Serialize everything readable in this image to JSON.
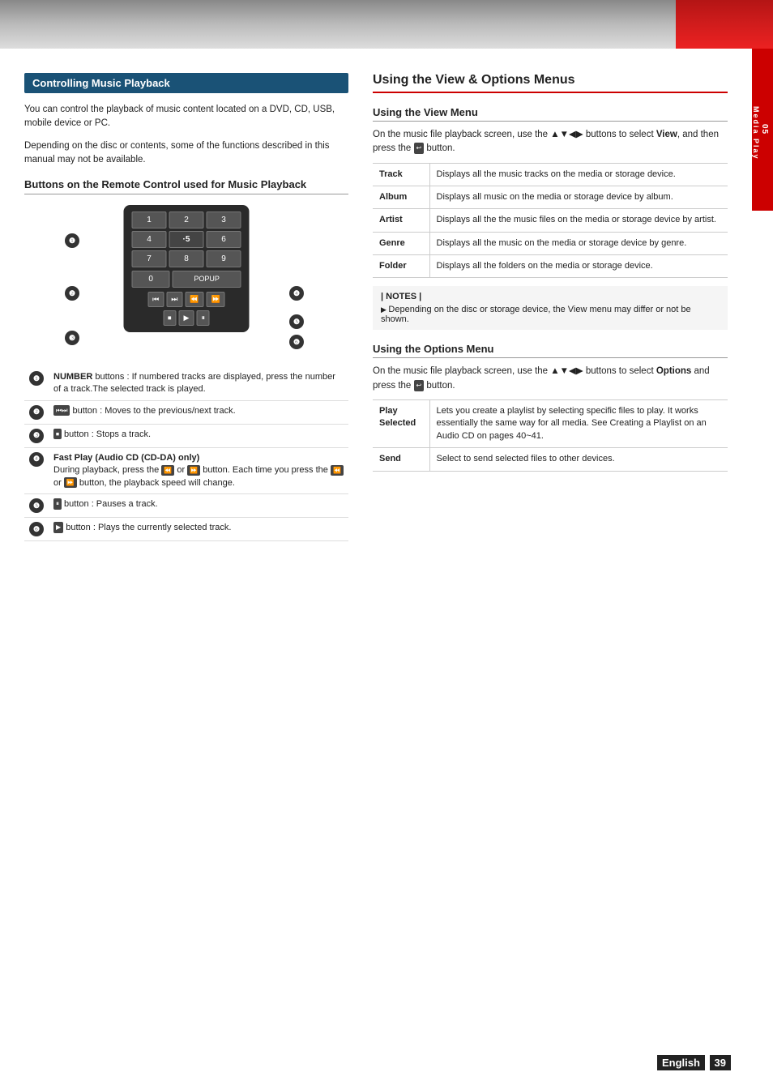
{
  "topBar": {
    "accentColor": "#cc0000"
  },
  "sideTab": {
    "line1": "05",
    "line2": "Media Play"
  },
  "leftSection": {
    "header": "Controlling Music Playback",
    "intro1": "You can control the playback of music content located on a DVD, CD, USB, mobile device or PC.",
    "intro2": "Depending on the disc or contents, some of the functions described in this manual may not be available.",
    "subsectionHeading": "Buttons on the Remote Control used for Music Playback",
    "descItems": [
      {
        "num": "❶",
        "text": "NUMBER buttons : If numbered tracks are displayed, press the number of a track.The selected track is played."
      },
      {
        "num": "❷",
        "text": "⏮ ⏭ button : Moves to the previous/next track."
      },
      {
        "num": "❸",
        "text": "⏹ button : Stops a track."
      },
      {
        "num": "❹",
        "boldLabel": "Fast Play (Audio CD (CD-DA) only)",
        "text": "During playback, press the ⏪ or ⏩ button. Each time you press the ⏪ or ⏩ button, the playback speed will change."
      },
      {
        "num": "❺",
        "text": "⏸ button : Pauses a track."
      },
      {
        "num": "❻",
        "text": "▶ button : Plays the currently selected track."
      }
    ]
  },
  "rightSection": {
    "mainHeading": "Using the View & Options Menus",
    "viewMenuHeading": "Using the View Menu",
    "viewMenuIntro": "On the music file playback screen, use the ▲▼◀▶ buttons to select View, and then press the  button.",
    "viewTableRows": [
      {
        "label": "Track",
        "desc": "Displays all the music tracks on the media or storage device."
      },
      {
        "label": "Album",
        "desc": "Displays all music on the media or storage device by album."
      },
      {
        "label": "Artist",
        "desc": "Displays all the the music files on the media or storage device by artist."
      },
      {
        "label": "Genre",
        "desc": "Displays all the music on the media or storage device by genre."
      },
      {
        "label": "Folder",
        "desc": "Displays all the folders on the media or storage device."
      }
    ],
    "notesTitle": "| NOTES |",
    "notesItems": [
      "Depending on the disc or storage device, the View menu may differ or not be shown."
    ],
    "optionsMenuHeading": "Using the Options Menu",
    "optionsMenuIntro": "On the music file playback screen, use the ▲▼◀▶ buttons to select Options and press the  button.",
    "optionsTableRows": [
      {
        "label": "Play Selected",
        "desc": "Lets you create a playlist by selecting specific files to play. It works essentially the same way for all media. See Creating a Playlist on an Audio CD on pages 40~41."
      },
      {
        "label": "Send",
        "desc": "Select to send selected files to other devices."
      }
    ]
  },
  "footer": {
    "label": "English",
    "pageNum": "39"
  },
  "remote": {
    "numpad": [
      "1",
      "2",
      "3",
      "4",
      "5",
      "6",
      "7",
      "8",
      "9"
    ],
    "zero": "0",
    "popup": "POPUP"
  }
}
